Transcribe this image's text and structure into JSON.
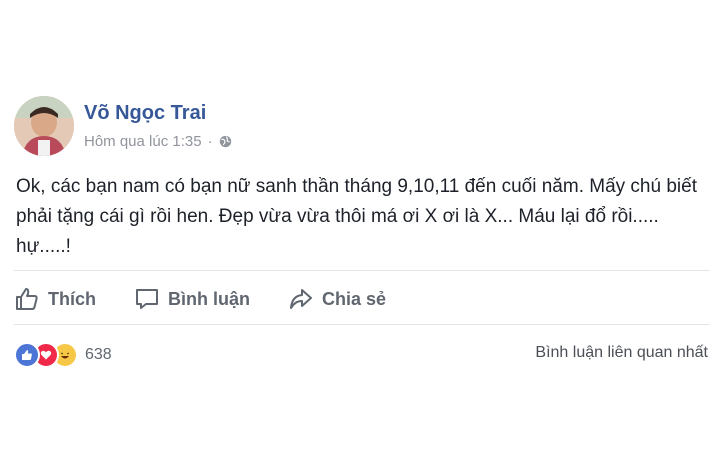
{
  "post": {
    "author": "Võ Ngọc Trai",
    "timestamp": "Hôm qua lúc 1:35",
    "separator": "·",
    "privacy_icon": "globe-icon",
    "content": "Ok, các bạn nam có bạn nữ sanh thần tháng 9,10,11 đến cuối năm. Mấy chú biết phải tặng cái gì rồi hen. Đẹp vừa vừa thôi má ơi X ơi là X... Máu lại đổ rồi..... hự.....!"
  },
  "actions": {
    "like_label": "Thích",
    "comment_label": "Bình luận",
    "share_label": "Chia sẻ"
  },
  "footer": {
    "reaction_icons": [
      "like-reaction-icon",
      "love-reaction-icon",
      "haha-reaction-icon"
    ],
    "reaction_count": "638",
    "sort_label": "Bình luận liên quan nhất"
  },
  "colors": {
    "author": "#365899",
    "action_text": "#606770",
    "meta_text": "#90949c",
    "like_reaction": "#4c75d6",
    "love_reaction": "#f0284a",
    "haha_reaction": "#f7c748"
  }
}
